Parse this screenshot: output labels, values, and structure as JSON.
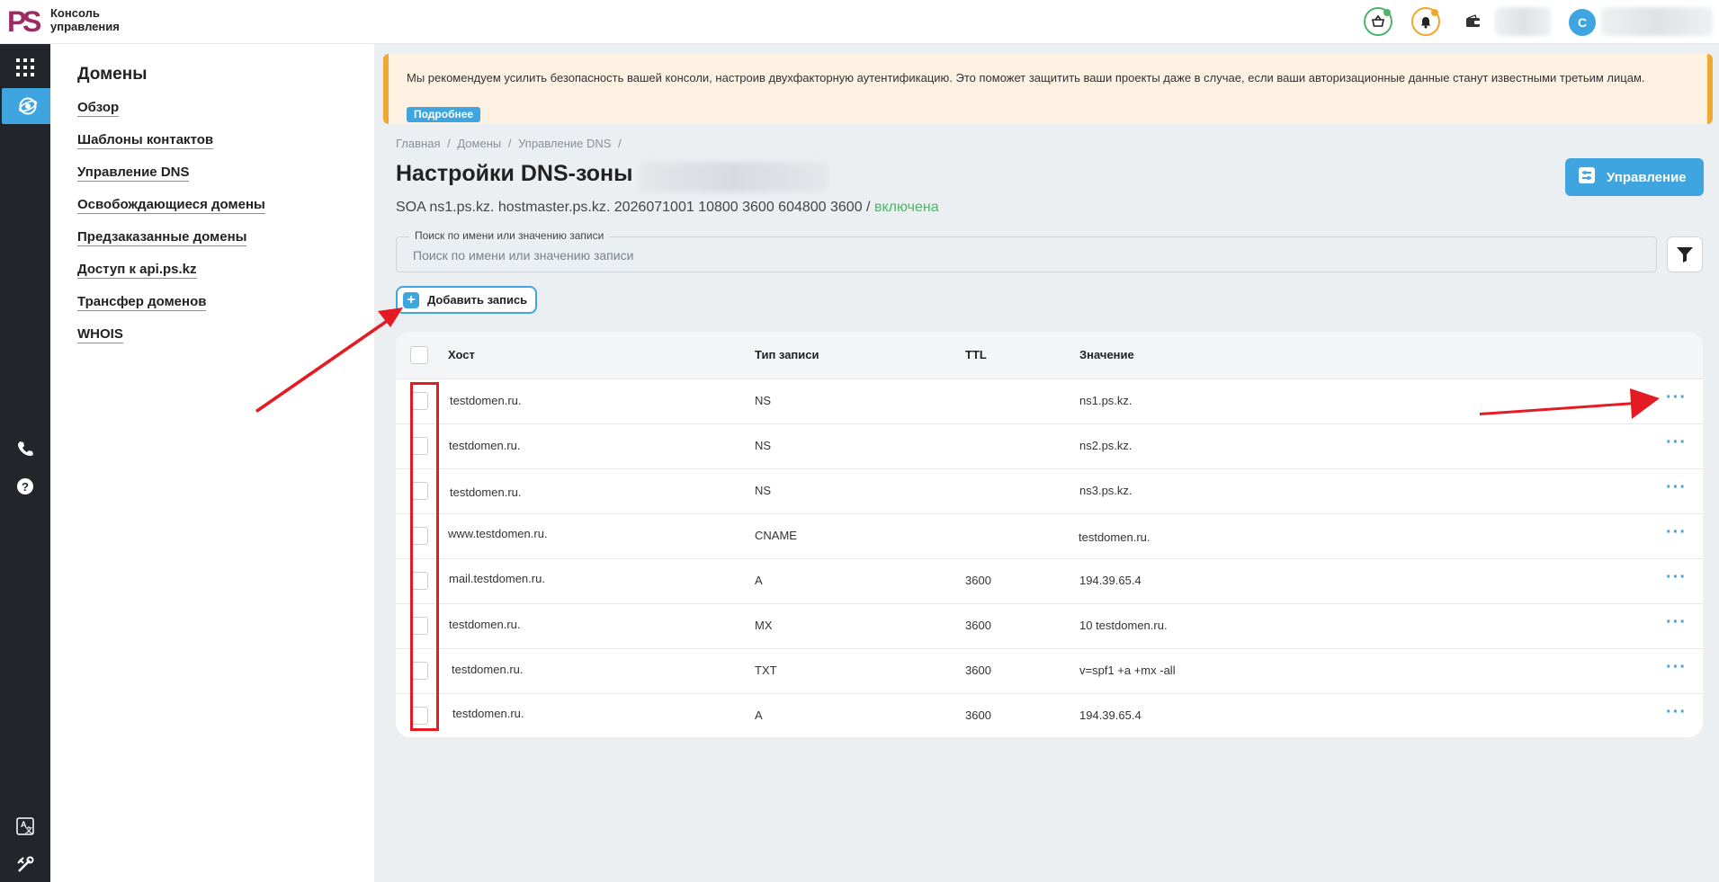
{
  "app": {
    "logo_text": "Консоль управления",
    "logo_letters": "PS"
  },
  "topbar": {
    "avatar_letter": "С"
  },
  "sidebar": {
    "title": "Домены",
    "items": [
      {
        "label": "Обзор"
      },
      {
        "label": "Шаблоны контактов"
      },
      {
        "label": "Управление DNS"
      },
      {
        "label": "Освобождающиеся домены"
      },
      {
        "label": "Предзаказанные домены"
      },
      {
        "label": "Доступ к api.ps.kz"
      },
      {
        "label": "Трансфер доменов"
      },
      {
        "label": "WHOIS"
      }
    ]
  },
  "alert": {
    "text": "Мы рекомендуем усилить безопасность вашей консоли, настроив двухфакторную аутентификацию. Это поможет защитить ваши проекты даже в случае, если ваши авторизационные данные станут известными третьим лицам.",
    "button": "Подробнее"
  },
  "breadcrumb": [
    "Главная",
    "/",
    "Домены",
    "/",
    "Управление DNS",
    "/"
  ],
  "page": {
    "title": "Настройки DNS-зоны",
    "manage_button": "Управление",
    "soa_text": "SOA ns1.ps.kz. hostmaster.ps.kz. 2026071001 10800 3600 604800 3600",
    "soa_sep": " / ",
    "soa_status": "включена"
  },
  "search": {
    "label": "Поиск по имени или значению записи",
    "placeholder": "Поиск по имени или значению записи"
  },
  "add_button": "Добавить запись",
  "table": {
    "headers": {
      "host": "Хост",
      "type": "Тип записи",
      "ttl": "TTL",
      "value": "Значение"
    },
    "rows": [
      {
        "host": "testdomen.ru.",
        "type": "NS",
        "ttl": "",
        "value": "ns1.ps.kz."
      },
      {
        "host": "testdomen.ru.",
        "type": "NS",
        "ttl": "",
        "value": "ns2.ps.kz."
      },
      {
        "host": "testdomen.ru.",
        "type": "NS",
        "ttl": "",
        "value": "ns3.ps.kz."
      },
      {
        "host": "www.testdomen.ru.",
        "type": "CNAME",
        "ttl": "",
        "value": "testdomen.ru."
      },
      {
        "host": "mail.testdomen.ru.",
        "type": "A",
        "ttl": "3600",
        "value": "194.39.65.4"
      },
      {
        "host": "testdomen.ru.",
        "type": "MX",
        "ttl": "3600",
        "value": "10 testdomen.ru."
      },
      {
        "host": "testdomen.ru.",
        "type": "TXT",
        "ttl": "3600",
        "value": "v=spf1 +a +mx -all"
      },
      {
        "host": "testdomen.ru.",
        "type": "A",
        "ttl": "3600",
        "value": "194.39.65.4"
      }
    ],
    "row_actions": "···"
  },
  "colors": {
    "accent": "#3fa5e0",
    "rail": "#22262b",
    "alert_border": "#f0a733",
    "status_ok": "#4db56a",
    "annotation": "#e51b24"
  }
}
